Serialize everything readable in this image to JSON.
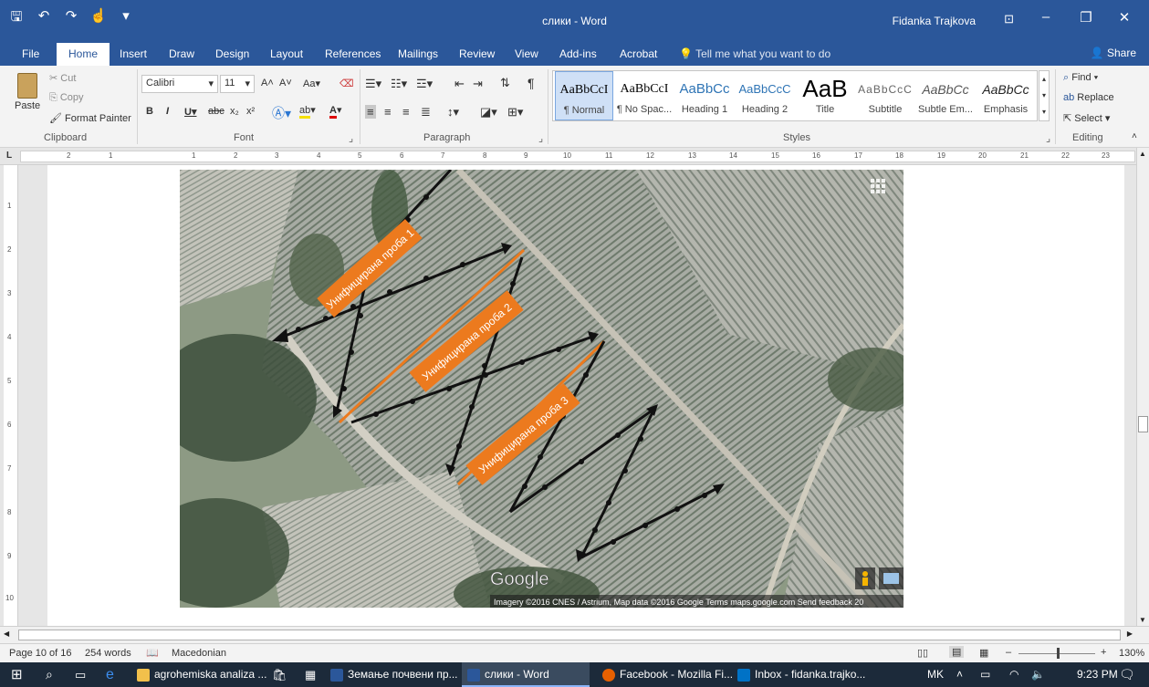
{
  "title_bar": {
    "doc_title": "слики - Word",
    "user_name": "Fidanka Trajkova"
  },
  "tabs": [
    "File",
    "Home",
    "Insert",
    "Draw",
    "Design",
    "Layout",
    "References",
    "Mailings",
    "Review",
    "View",
    "Add-ins",
    "Acrobat"
  ],
  "tell_me": "Tell me what you want to do",
  "share": "Share",
  "clipboard": {
    "paste": "Paste",
    "cut": "Cut",
    "copy": "Copy",
    "format_painter": "Format Painter",
    "label": "Clipboard"
  },
  "font": {
    "name": "Calibri",
    "size": "11",
    "label": "Font"
  },
  "paragraph": {
    "label": "Paragraph"
  },
  "styles": {
    "label": "Styles",
    "items": [
      {
        "preview": "AaBbCcI",
        "name": "¶ Normal"
      },
      {
        "preview": "AaBbCcI",
        "name": "¶ No Spac..."
      },
      {
        "preview": "AaBbCc",
        "name": "Heading 1"
      },
      {
        "preview": "AaBbCcC",
        "name": "Heading 2"
      },
      {
        "preview": "AaB",
        "name": "Title"
      },
      {
        "preview": "AaBbCcC",
        "name": "Subtitle"
      },
      {
        "preview": "AaBbCc",
        "name": "Subtle Em..."
      },
      {
        "preview": "AaBbCc",
        "name": "Emphasis"
      }
    ]
  },
  "editing": {
    "find": "Find",
    "replace": "Replace",
    "select": "Select",
    "label": "Editing"
  },
  "image": {
    "labels": [
      "Унифицирана проба 1",
      "Унифицирана проба 2",
      "Унифицирана проба 3"
    ],
    "google": "Google",
    "attribution": "Imagery ©2016 CNES / Astrium, Map data ©2016 Google   Terms   maps.google.com   Send feedback   20"
  },
  "colors": {
    "accent": "#2b579a",
    "sample_label": "#ec7a1e"
  },
  "status": {
    "page": "Page 10 of 16",
    "words": "254 words",
    "language": "Macedonian",
    "zoom": "130%"
  },
  "taskbar": {
    "items": [
      "agrohemiska analiza ...",
      "Земање почвени пр...",
      "слики - Word",
      "Facebook - Mozilla Fi...",
      "Inbox - fidanka.trajko..."
    ],
    "lang": "MK",
    "time": "9:23 PM"
  }
}
